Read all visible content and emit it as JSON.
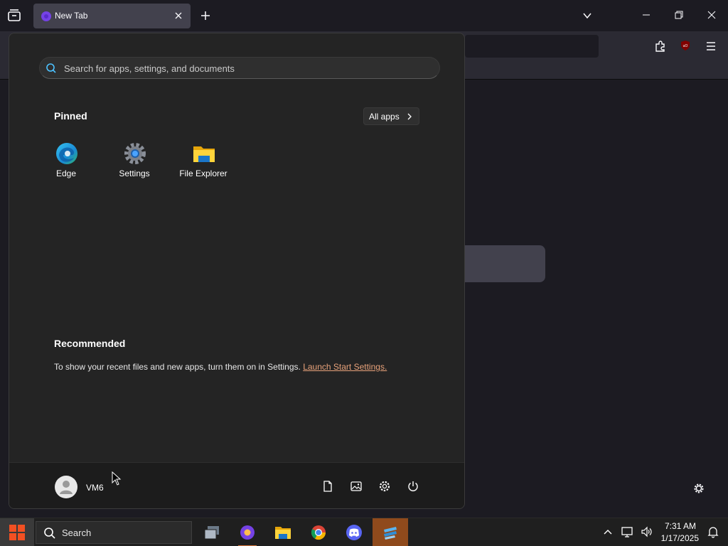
{
  "browser": {
    "tab": {
      "title": "New Tab"
    }
  },
  "start_menu": {
    "search_placeholder": "Search for apps, settings, and documents",
    "pinned_heading": "Pinned",
    "all_apps_label": "All apps",
    "pinned": [
      {
        "label": "Edge",
        "icon": "edge-icon"
      },
      {
        "label": "Settings",
        "icon": "settings-gear-icon"
      },
      {
        "label": "File Explorer",
        "icon": "folder-icon"
      }
    ],
    "recommended_heading": "Recommended",
    "recommended_text": "To show your recent files and new apps, turn them on in Settings.",
    "recommended_link": "Launch Start Settings.",
    "user_name": "VM6",
    "footer_buttons": [
      "documents-icon",
      "pictures-icon",
      "settings-icon",
      "power-icon"
    ]
  },
  "taskbar": {
    "search_label": "Search",
    "apps": [
      "task-view-icon",
      "firefox-icon",
      "file-explorer-icon",
      "chrome-icon",
      "discord-icon",
      "app-icon"
    ],
    "clock_time": "7:31 AM",
    "clock_date": "1/17/2025"
  },
  "colors": {
    "accent": "#d97638",
    "link": "#e8a27a",
    "start_bg": "#242424"
  }
}
